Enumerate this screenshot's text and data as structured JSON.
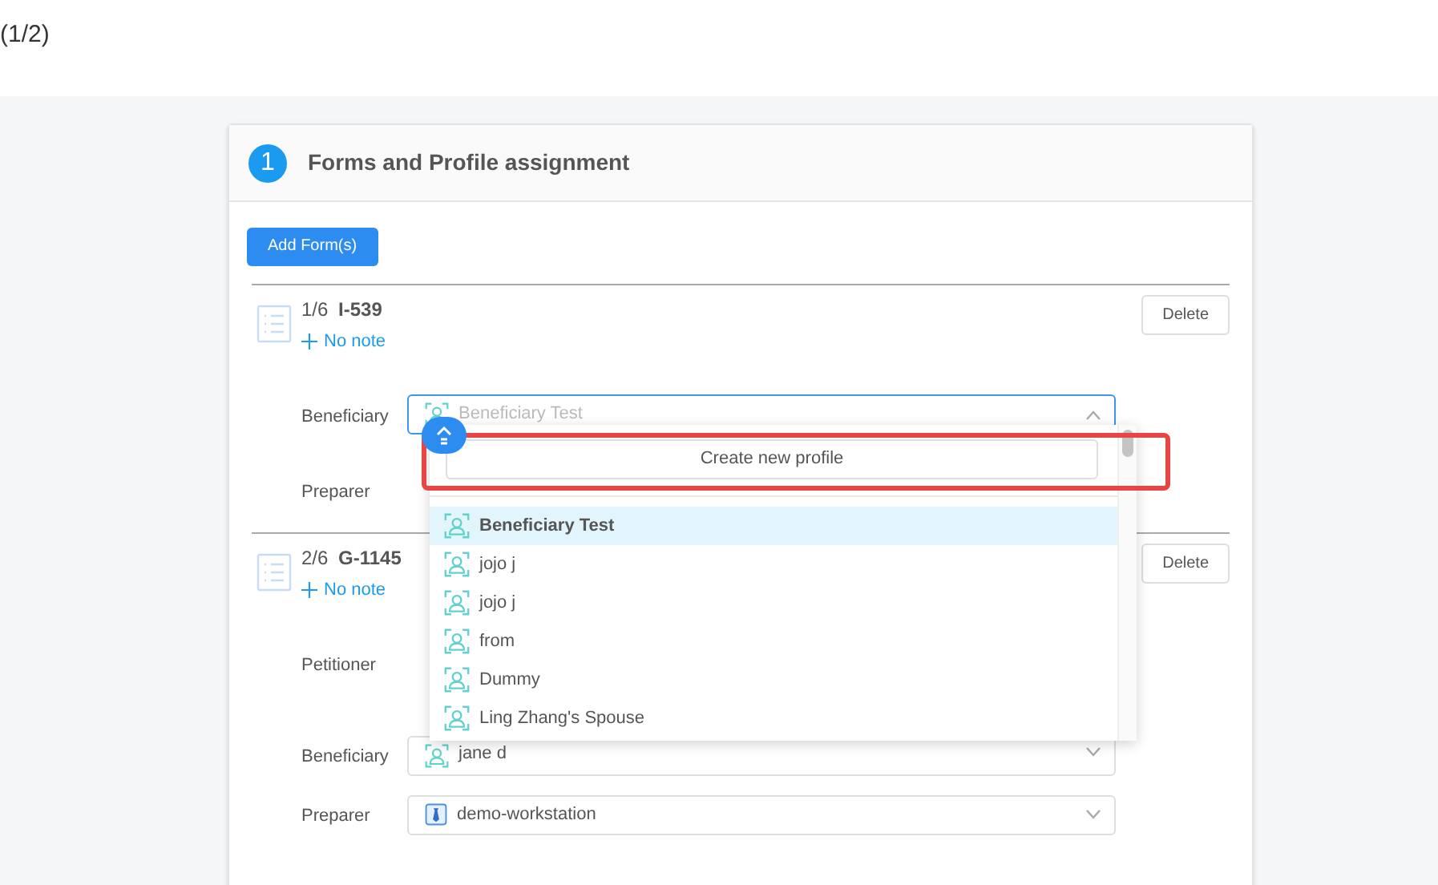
{
  "page_counter": "(1/2)",
  "section": {
    "number": "1",
    "title": "Forms and Profile assignment"
  },
  "add_button": "Add Form(s)",
  "forms": [
    {
      "index": "1/6",
      "code": "I-539",
      "note": "No note",
      "delete": "Delete",
      "fields": [
        {
          "label": "Beneficiary",
          "placeholder": "Beneficiary Test",
          "kind": "person",
          "open": true
        },
        {
          "label": "Preparer"
        }
      ]
    },
    {
      "index": "2/6",
      "code": "G-1145",
      "note": "No note",
      "delete": "Delete",
      "fields": [
        {
          "label": "Petitioner"
        },
        {
          "label": "Beneficiary",
          "value": "jane d",
          "kind": "person",
          "open": false
        },
        {
          "label": "Preparer",
          "value": "demo-workstation",
          "kind": "workstation",
          "open": false
        }
      ]
    }
  ],
  "dropdown": {
    "create_button": "Create new profile",
    "highlighted": true,
    "options": [
      {
        "label": "Beneficiary Test",
        "selected": true
      },
      {
        "label": "jojo j",
        "selected": false
      },
      {
        "label": "jojo j",
        "selected": false
      },
      {
        "label": "from",
        "selected": false
      },
      {
        "label": "Dummy",
        "selected": false
      },
      {
        "label": "Ling Zhang's Spouse",
        "selected": false
      }
    ]
  }
}
